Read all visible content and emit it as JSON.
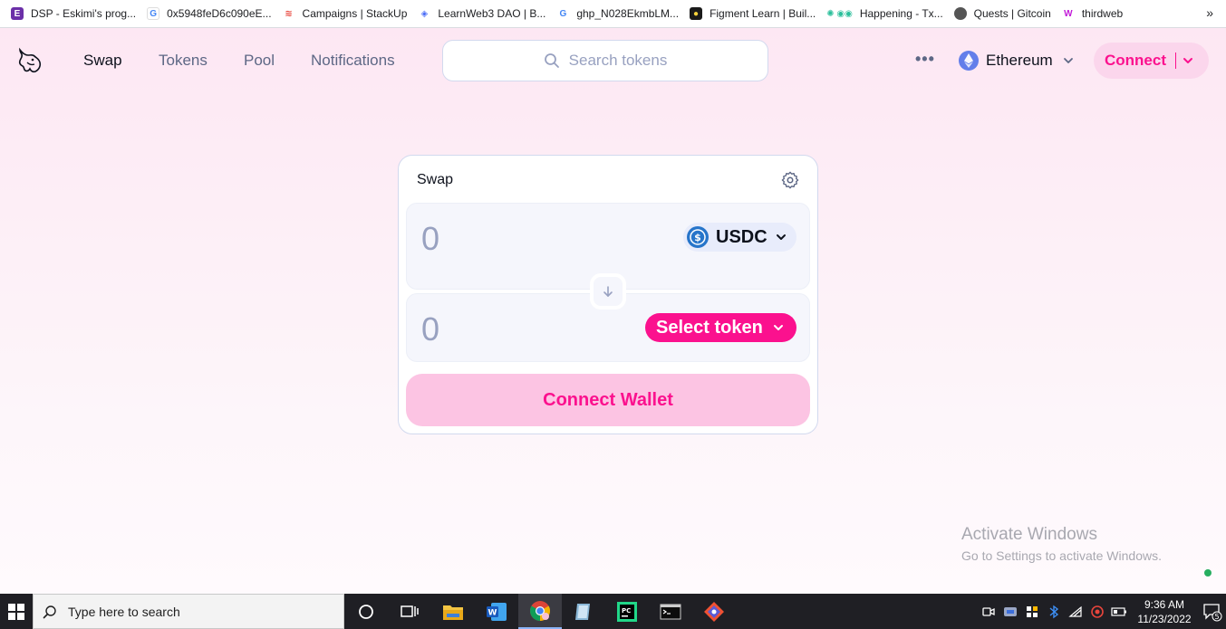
{
  "bookmarks": [
    {
      "label": "DSP - Eskimi's prog...",
      "icon": "eskimi-icon",
      "color": "#6b2fa8"
    },
    {
      "label": "0x5948feD6c090eE...",
      "icon": "google-icon",
      "color": "#4285f4"
    },
    {
      "label": "Campaigns | StackUp",
      "icon": "stackup-icon",
      "color": "#e8453c"
    },
    {
      "label": "LearnWeb3 DAO | B...",
      "icon": "learnweb3-icon",
      "color": "#4a6cf7"
    },
    {
      "label": "ghp_N028EkmbLM...",
      "icon": "google-icon",
      "color": "#4285f4"
    },
    {
      "label": "Figment Learn | Buil...",
      "icon": "figment-icon",
      "color": "#1a1a1a"
    },
    {
      "label": "Happening - Tx...",
      "icon": "happening-icon",
      "color": "#2bbf9b"
    },
    {
      "label": "Quests | Gitcoin",
      "icon": "gitcoin-icon",
      "color": "#555555"
    },
    {
      "label": "thirdweb",
      "icon": "thirdweb-icon",
      "color": "#c21ad8"
    }
  ],
  "bookmarks_more": "»",
  "nav": {
    "links": [
      "Swap",
      "Tokens",
      "Pool",
      "Notifications"
    ],
    "active": "Swap",
    "search_placeholder": "Search tokens",
    "more": "•••",
    "chain": "Ethereum",
    "connect": "Connect"
  },
  "swap": {
    "title": "Swap",
    "input_amount": "0",
    "input_token": "USDC",
    "output_amount": "0",
    "select_token": "Select token",
    "connect_wallet": "Connect Wallet"
  },
  "watermark": {
    "line1": "Activate Windows",
    "line2": "Go to Settings to activate Windows."
  },
  "taskbar": {
    "search": "Type here to search",
    "time": "9:36 AM",
    "date": "11/23/2022",
    "notifications": "5"
  },
  "colors": {
    "accent": "#fb118e",
    "accent_light": "#fbd6ec",
    "background": "#fde7f3"
  }
}
